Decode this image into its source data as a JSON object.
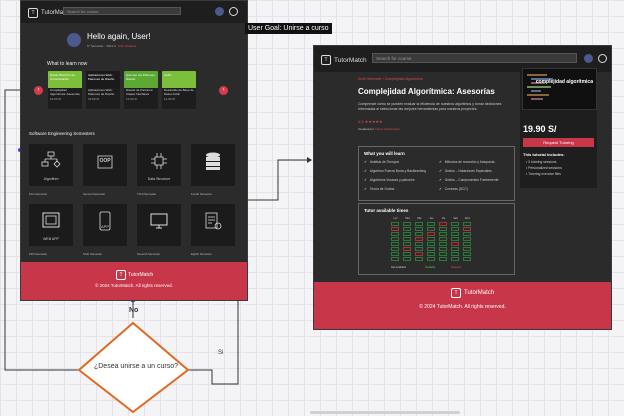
{
  "goal_label": "User Goal: Unirse a curso",
  "decision": {
    "question": "¿Desea unirse a un curso?",
    "no_label": "No",
    "yes_label": "Si"
  },
  "colors": {
    "accent": "#c8364a",
    "decision_border": "#e06a22",
    "flow_line": "#333333",
    "handle": "#3a4ad8"
  },
  "home": {
    "brand": "TutorMatch",
    "search_placeholder": "Search for course",
    "greeting": "Hello again, User!",
    "subline_prefix": "5° Semester · 2024-II · ",
    "subline_link": "Edit schedule",
    "learn_title": "What to learn now",
    "courses": [
      {
        "thumb": "Power Bind Pro de Comunicación",
        "title": "Complejidad Algorítmica: Asesorías",
        "price": "19.90 S/"
      },
      {
        "thumb": "Aplicaciones Web: Patrones de Diseño",
        "title": "Aplicaciones Web: Patrones de Diseño",
        "price": "19.90 S/"
      },
      {
        "thumb": "Qué son los Patrones Diseño",
        "title": "Diseño de Patrones: Clases Interfaces",
        "price": "14.90 S/"
      },
      {
        "thumb": "Kotlin",
        "title": "Desarrollo de Base de Datos Kotlin",
        "price": "14.90 S/"
      }
    ],
    "section_title": "Software Engineering Semesters",
    "tiles": [
      {
        "name": "Algorithm",
        "caption": "First Semester"
      },
      {
        "name": "OOP",
        "caption": "Second Semester"
      },
      {
        "name": "Data Structure",
        "caption": "Third Semester"
      },
      {
        "name": "",
        "caption": "Fourth Semester"
      },
      {
        "name": "WEB APP",
        "caption": "Fifth Semester"
      },
      {
        "name": "APP",
        "caption": "Sixth Semester"
      },
      {
        "name": "",
        "caption": "Seventh Semester"
      },
      {
        "name": "",
        "caption": "Eighth Semester"
      }
    ],
    "footer_brand": "TutorMatch",
    "footer_copy": "© 2024 TutorMatch. All rights reserved."
  },
  "detail": {
    "brand": "TutorMatch",
    "search_placeholder": "Search for course",
    "breadcrumb": "Sixth Semester  ›  Complejidad Algorítmica",
    "title": "Complejidad Algorítmica: Asesorías",
    "description": "Comprende cómo se pueden evaluar la eficiencia de nuestros algoritmos y tomar decisiones informadas al seleccionar las mejores herramientas para nuestros proyectos.",
    "rating": "4.5 ★★★★★",
    "created_by_prefix": "Created por ",
    "created_by_name": "Carlos Santamaría",
    "thumb_text": "complejidad algorítmica",
    "price": "19.90 S/",
    "request_button": "Request Tutoring",
    "includes_title": "This tutorial includes:",
    "includes": [
      "3 tutoring sessions",
      "Personalized sessions",
      "Tutoring exercise files"
    ],
    "learn_title": "What you will learn",
    "learn_items": [
      "Análisis de Tiempos",
      "Métodos de recursión y búsqueda",
      "Algoritmo Fuerza Bruta y Backtracking",
      "Grafos – Notaciones Especiales",
      "Algoritmos Voraces y patrones",
      "Grafos – Componentes Fuertemente",
      "Teoría de Grafos",
      "Conexas (SCC)"
    ],
    "avail_title": "Tutor available times",
    "days": [
      "Lun",
      "Mar",
      "Mie",
      "Jue",
      "Vie",
      "Sab",
      "Dom"
    ],
    "legend": [
      "Not Available",
      "Available",
      "Selected"
    ],
    "footer_brand": "TutorMatch",
    "footer_copy": "© 2024 TutorMatch. All rights reserved."
  }
}
